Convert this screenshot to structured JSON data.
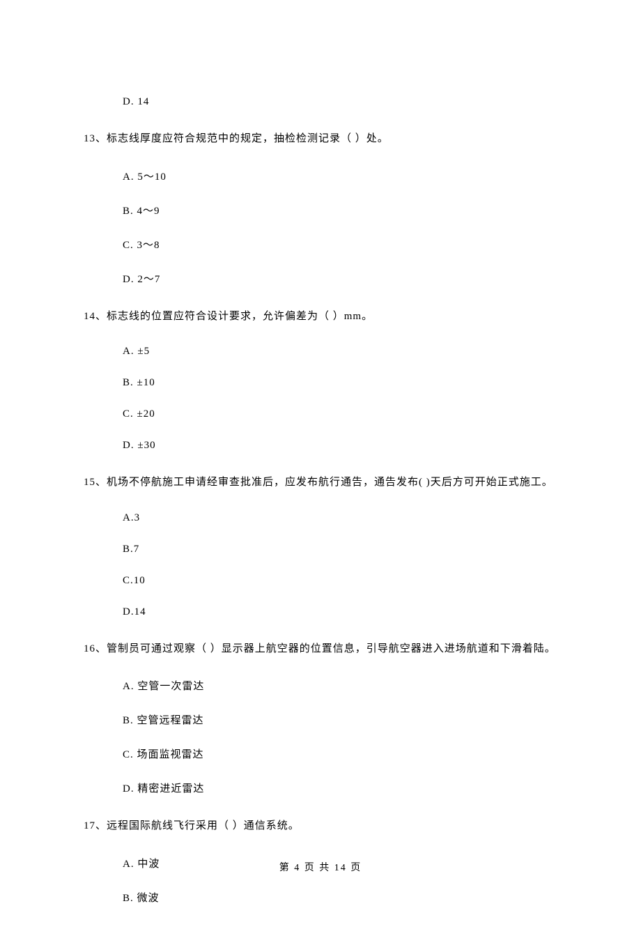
{
  "orphan_option": "D. 14",
  "questions": [
    {
      "text": "13、标志线厚度应符合规范中的规定，抽检检测记录（    ）处。",
      "options": [
        "A. 5～10",
        "B. 4～9",
        "C. 3～8",
        "D. 2～7"
      ]
    },
    {
      "text": "14、标志线的位置应符合设计要求，允许偏差为（    ）mm。",
      "options": [
        "A. ±5",
        "B. ±10",
        "C. ±20",
        "D. ±30"
      ]
    },
    {
      "text": "15、机场不停航施工申请经审查批准后，应发布航行通告，通告发布(    )天后方可开始正式施工。",
      "options": [
        "A.3",
        "B.7",
        "C.10",
        "D.14"
      ]
    },
    {
      "text": "16、管制员可通过观察（    ）显示器上航空器的位置信息，引导航空器进入进场航道和下滑着陆。",
      "options": [
        "A. 空管一次雷达",
        "B. 空管远程雷达",
        "C. 场面监视雷达",
        "D. 精密进近雷达"
      ]
    },
    {
      "text": "17、远程国际航线飞行采用（    ）通信系统。",
      "options": [
        "A. 中波",
        "B. 微波"
      ]
    }
  ],
  "footer": "第 4 页 共 14 页"
}
